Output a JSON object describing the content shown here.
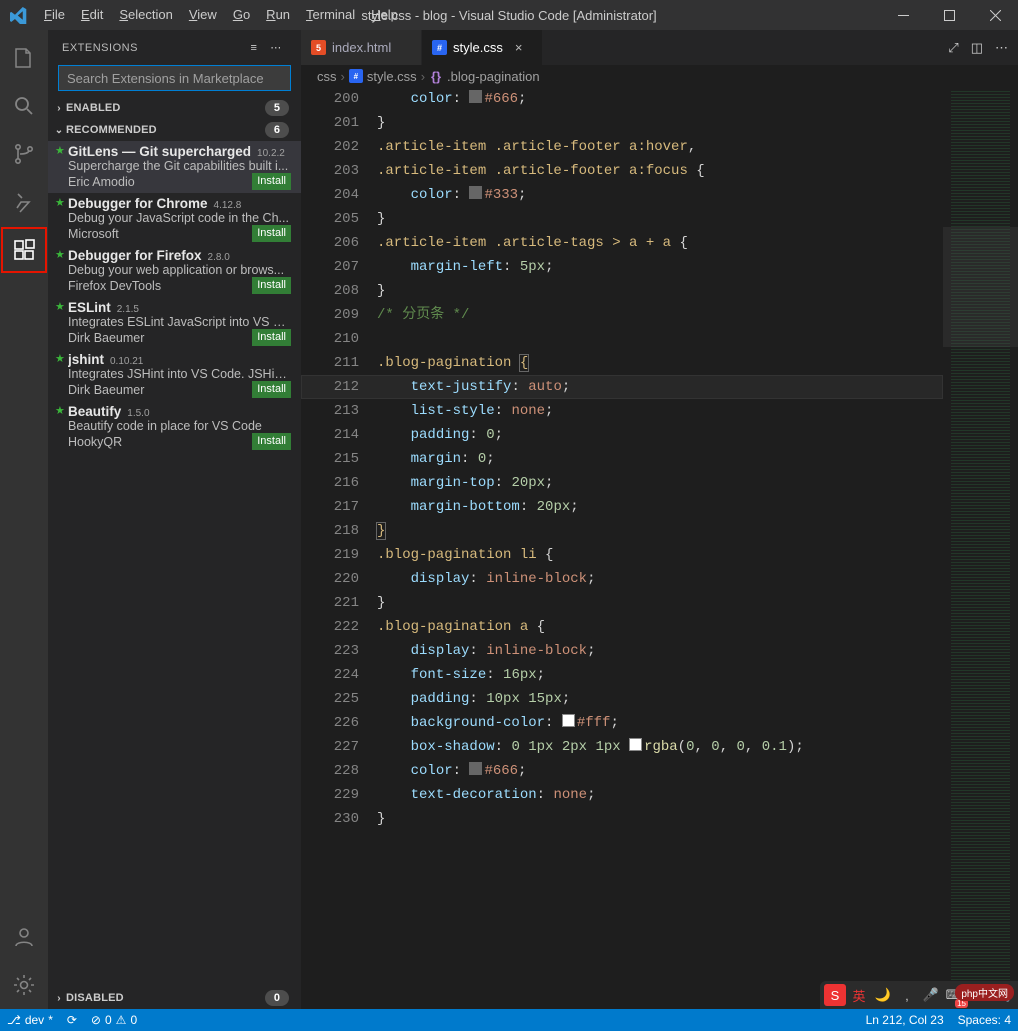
{
  "title": "style.css - blog - Visual Studio Code [Administrator]",
  "menu": [
    "File",
    "Edit",
    "Selection",
    "View",
    "Go",
    "Run",
    "Terminal",
    "Help"
  ],
  "activitybar": {
    "items": [
      {
        "name": "explorer",
        "icon": "files"
      },
      {
        "name": "search",
        "icon": "search"
      },
      {
        "name": "scm",
        "icon": "branch"
      },
      {
        "name": "debug",
        "icon": "bug"
      },
      {
        "name": "extensions",
        "icon": "extensions",
        "active": true,
        "highlight": true
      }
    ],
    "bottom": [
      {
        "name": "account",
        "icon": "account"
      },
      {
        "name": "settings",
        "icon": "gear"
      }
    ]
  },
  "sidebar": {
    "title": "EXTENSIONS",
    "search_placeholder": "Search Extensions in Marketplace",
    "sections": {
      "enabled": {
        "label": "ENABLED",
        "count": "5",
        "expanded": false
      },
      "recommended": {
        "label": "RECOMMENDED",
        "count": "6",
        "expanded": true
      },
      "disabled": {
        "label": "DISABLED",
        "count": "0",
        "expanded": false
      }
    },
    "extensions": [
      {
        "name": "GitLens — Git supercharged",
        "ver": "10.2.2",
        "desc": "Supercharge the Git capabilities built i...",
        "pub": "Eric Amodio",
        "action": "Install"
      },
      {
        "name": "Debugger for Chrome",
        "ver": "4.12.8",
        "desc": "Debug your JavaScript code in the Ch...",
        "pub": "Microsoft",
        "action": "Install"
      },
      {
        "name": "Debugger for Firefox",
        "ver": "2.8.0",
        "desc": "Debug your web application or brows...",
        "pub": "Firefox DevTools",
        "action": "Install"
      },
      {
        "name": "ESLint",
        "ver": "2.1.5",
        "desc": "Integrates ESLint JavaScript into VS C...",
        "pub": "Dirk Baeumer",
        "action": "Install"
      },
      {
        "name": "jshint",
        "ver": "0.10.21",
        "desc": "Integrates JSHint into VS Code. JSHint...",
        "pub": "Dirk Baeumer",
        "action": "Install"
      },
      {
        "name": "Beautify",
        "ver": "1.5.0",
        "desc": "Beautify code in place for VS Code",
        "pub": "HookyQR",
        "action": "Install"
      }
    ]
  },
  "tabs": [
    {
      "label": "index.html",
      "type": "html",
      "active": false
    },
    {
      "label": "style.css",
      "type": "css",
      "active": true
    }
  ],
  "breadcrumb": [
    "css",
    "style.css",
    ".blog-pagination"
  ],
  "code": [
    {
      "n": 200,
      "segs": [
        [
          "",
          "    "
        ],
        [
          "prop",
          "color"
        ],
        [
          "punc",
          ": "
        ],
        [
          "sw",
          ""
        ],
        [
          "val",
          "#666"
        ],
        [
          "punc",
          ";"
        ]
      ]
    },
    {
      "n": 201,
      "segs": [
        [
          "brkt",
          "}"
        ]
      ]
    },
    {
      "n": 202,
      "segs": [
        [
          "sel",
          ".article-item .article-footer a:hover"
        ],
        [
          "punc",
          ","
        ]
      ]
    },
    {
      "n": 203,
      "segs": [
        [
          "sel",
          ".article-item .article-footer a:focus"
        ],
        [
          "punc",
          " "
        ],
        [
          "brkt",
          "{"
        ]
      ]
    },
    {
      "n": 204,
      "segs": [
        [
          "",
          "    "
        ],
        [
          "prop",
          "color"
        ],
        [
          "punc",
          ": "
        ],
        [
          "sw",
          ""
        ],
        [
          "val",
          "#333"
        ],
        [
          "punc",
          ";"
        ]
      ]
    },
    {
      "n": 205,
      "segs": [
        [
          "brkt",
          "}"
        ]
      ]
    },
    {
      "n": 206,
      "segs": [
        [
          "sel",
          ".article-item .article-tags > a + a"
        ],
        [
          "punc",
          " "
        ],
        [
          "brkt",
          "{"
        ]
      ]
    },
    {
      "n": 207,
      "segs": [
        [
          "",
          "    "
        ],
        [
          "prop",
          "margin-left"
        ],
        [
          "punc",
          ": "
        ],
        [
          "num",
          "5px"
        ],
        [
          "punc",
          ";"
        ]
      ]
    },
    {
      "n": 208,
      "segs": [
        [
          "brkt",
          "}"
        ]
      ]
    },
    {
      "n": 209,
      "segs": [
        [
          "cmt",
          "/* 分页条 */"
        ]
      ]
    },
    {
      "n": 210,
      "segs": []
    },
    {
      "n": 211,
      "segs": [
        [
          "sel",
          ".blog-pagination"
        ],
        [
          "punc",
          " "
        ],
        [
          "brkt-hl",
          "{"
        ]
      ]
    },
    {
      "n": 212,
      "segs": [
        [
          "",
          "    "
        ],
        [
          "prop",
          "text-justify"
        ],
        [
          "punc",
          ": "
        ],
        [
          "val",
          "auto"
        ],
        [
          "punc",
          ";"
        ]
      ],
      "current": true
    },
    {
      "n": 213,
      "segs": [
        [
          "",
          "    "
        ],
        [
          "prop",
          "list-style"
        ],
        [
          "punc",
          ": "
        ],
        [
          "val",
          "none"
        ],
        [
          "punc",
          ";"
        ]
      ]
    },
    {
      "n": 214,
      "segs": [
        [
          "",
          "    "
        ],
        [
          "prop",
          "padding"
        ],
        [
          "punc",
          ": "
        ],
        [
          "num",
          "0"
        ],
        [
          "punc",
          ";"
        ]
      ]
    },
    {
      "n": 215,
      "segs": [
        [
          "",
          "    "
        ],
        [
          "prop",
          "margin"
        ],
        [
          "punc",
          ": "
        ],
        [
          "num",
          "0"
        ],
        [
          "punc",
          ";"
        ]
      ]
    },
    {
      "n": 216,
      "segs": [
        [
          "",
          "    "
        ],
        [
          "prop",
          "margin-top"
        ],
        [
          "punc",
          ": "
        ],
        [
          "num",
          "20px"
        ],
        [
          "punc",
          ";"
        ]
      ]
    },
    {
      "n": 217,
      "segs": [
        [
          "",
          "    "
        ],
        [
          "prop",
          "margin-bottom"
        ],
        [
          "punc",
          ": "
        ],
        [
          "num",
          "20px"
        ],
        [
          "punc",
          ";"
        ]
      ]
    },
    {
      "n": 218,
      "segs": [
        [
          "brkt-hl",
          "}"
        ]
      ]
    },
    {
      "n": 219,
      "segs": [
        [
          "sel",
          ".blog-pagination li"
        ],
        [
          "punc",
          " "
        ],
        [
          "brkt",
          "{"
        ]
      ]
    },
    {
      "n": 220,
      "segs": [
        [
          "",
          "    "
        ],
        [
          "prop",
          "display"
        ],
        [
          "punc",
          ": "
        ],
        [
          "val",
          "inline-block"
        ],
        [
          "punc",
          ";"
        ]
      ]
    },
    {
      "n": 221,
      "segs": [
        [
          "brkt",
          "}"
        ]
      ]
    },
    {
      "n": 222,
      "segs": [
        [
          "sel",
          ".blog-pagination a"
        ],
        [
          "punc",
          " "
        ],
        [
          "brkt",
          "{"
        ]
      ]
    },
    {
      "n": 223,
      "segs": [
        [
          "",
          "    "
        ],
        [
          "prop",
          "display"
        ],
        [
          "punc",
          ": "
        ],
        [
          "val",
          "inline-block"
        ],
        [
          "punc",
          ";"
        ]
      ]
    },
    {
      "n": 224,
      "segs": [
        [
          "",
          "    "
        ],
        [
          "prop",
          "font-size"
        ],
        [
          "punc",
          ": "
        ],
        [
          "num",
          "16px"
        ],
        [
          "punc",
          ";"
        ]
      ]
    },
    {
      "n": 225,
      "segs": [
        [
          "",
          "    "
        ],
        [
          "prop",
          "padding"
        ],
        [
          "punc",
          ": "
        ],
        [
          "num",
          "10px 15px"
        ],
        [
          "punc",
          ";"
        ]
      ]
    },
    {
      "n": 226,
      "segs": [
        [
          "",
          "    "
        ],
        [
          "prop",
          "background-color"
        ],
        [
          "punc",
          ": "
        ],
        [
          "sww",
          ""
        ],
        [
          "val",
          "#fff"
        ],
        [
          "punc",
          ";"
        ]
      ]
    },
    {
      "n": 227,
      "segs": [
        [
          "",
          "    "
        ],
        [
          "prop",
          "box-shadow"
        ],
        [
          "punc",
          ": "
        ],
        [
          "num",
          "0 1px 2px 1px "
        ],
        [
          "sww",
          ""
        ],
        [
          "fn",
          "rgba"
        ],
        [
          "punc",
          "("
        ],
        [
          "num",
          "0"
        ],
        [
          "punc",
          ", "
        ],
        [
          "num",
          "0"
        ],
        [
          "punc",
          ", "
        ],
        [
          "num",
          "0"
        ],
        [
          "punc",
          ", "
        ],
        [
          "num",
          "0.1"
        ],
        [
          "punc",
          ")"
        ],
        [
          "punc",
          ";"
        ]
      ]
    },
    {
      "n": 228,
      "segs": [
        [
          "",
          "    "
        ],
        [
          "prop",
          "color"
        ],
        [
          "punc",
          ": "
        ],
        [
          "sw",
          ""
        ],
        [
          "val",
          "#666"
        ],
        [
          "punc",
          ";"
        ]
      ]
    },
    {
      "n": 229,
      "segs": [
        [
          "",
          "    "
        ],
        [
          "prop",
          "text-decoration"
        ],
        [
          "punc",
          ": "
        ],
        [
          "val",
          "none"
        ],
        [
          "punc",
          ";"
        ]
      ]
    },
    {
      "n": 230,
      "segs": [
        [
          "brkt",
          "}"
        ]
      ]
    }
  ],
  "status": {
    "branch": "dev",
    "sync": "",
    "problems": "0",
    "warnings": "0",
    "cursor": "Ln 212, Col 23",
    "spaces": "Spaces: 4"
  },
  "watermark": "php中文网"
}
